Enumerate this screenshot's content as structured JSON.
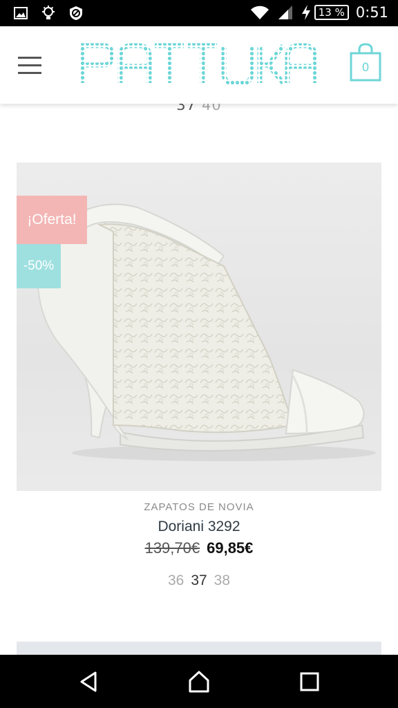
{
  "status_bar": {
    "battery": "13 %",
    "time": "0:51"
  },
  "header": {
    "logo_text": "PATTUKA",
    "cart_count": "0"
  },
  "previous_product": {
    "sizes_visible": "37",
    "sizes_muted": "40"
  },
  "product": {
    "badge_offer": "¡Oferta!",
    "badge_discount": "-50%",
    "category": "ZAPATOS DE NOVIA",
    "name": "Doriani 3292",
    "price_old": "139,70€",
    "price_new": "69,85€",
    "sizes": [
      {
        "label": "36",
        "available": false
      },
      {
        "label": "37",
        "available": true
      },
      {
        "label": "38",
        "available": false
      }
    ]
  },
  "colors": {
    "brand_teal": "#6fd6d8",
    "offer_pink": "#f4b6b4",
    "discount_teal": "#9edfe0"
  },
  "nav_bar": {
    "back_icon": "back-icon",
    "home_icon": "home-icon",
    "recents_icon": "recents-icon"
  }
}
